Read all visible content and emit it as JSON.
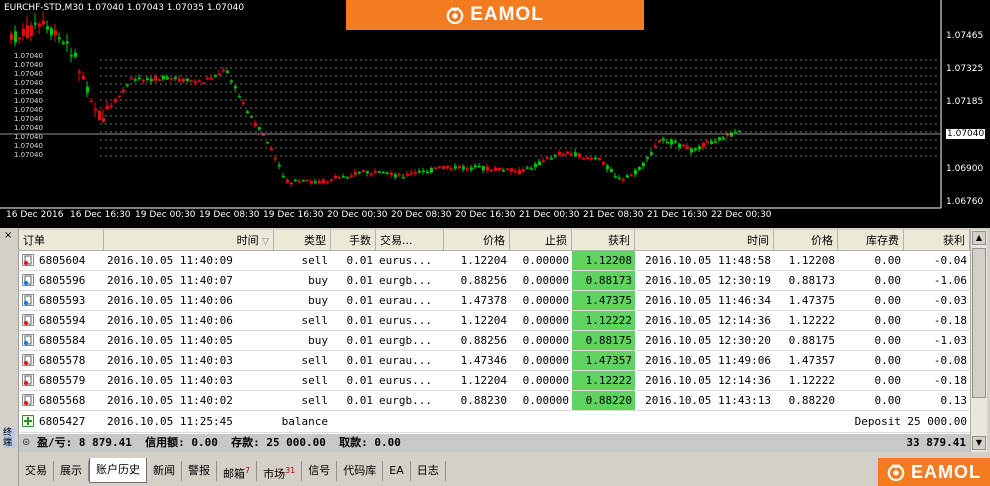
{
  "chart": {
    "title": "EURCHF-STD,M30  1.07040 1.07043 1.07035 1.07040",
    "y_labels": [
      "1.07465",
      "1.07325",
      "1.07185",
      "1.07040",
      "1.06900",
      "1.06760"
    ],
    "x_labels": [
      "16 Dec 2016",
      "16 Dec 16:30",
      "19 Dec 00:30",
      "19 Dec 08:30",
      "19 Dec 16:30",
      "20 Dec 00:30",
      "20 Dec 08:30",
      "20 Dec 16:30",
      "21 Dec 00:30",
      "21 Dec 08:30",
      "21 Dec 16:30",
      "22 Dec 00:30"
    ],
    "current_price": "1.07040",
    "colors": {
      "background": "#000000",
      "bull": "#00c800",
      "bear": "#e01010",
      "grid": "#ffffff"
    },
    "level_label_text": "1.07040"
  },
  "brand": {
    "text": "EAMOL",
    "color": "#f47c20"
  },
  "terminal": {
    "close_glyph": "×",
    "vertical_title": "终端",
    "headers": {
      "order": "订单",
      "time": "时间",
      "type": "类型",
      "lots": "手数",
      "symbol": "交易...",
      "price": "价格",
      "sl": "止损",
      "tp": "获利",
      "time2": "时间",
      "price2": "价格",
      "swap": "库存费",
      "profit": "获利"
    },
    "rows": [
      {
        "order": "6805604",
        "open_time": "2016.10.05 11:40:09",
        "type": "sell",
        "lots": "0.01",
        "symbol": "eurus...",
        "price": "1.12204",
        "sl": "0.00000",
        "tp": "1.12208",
        "close_time": "2016.10.05 11:48:58",
        "close_price": "1.12208",
        "swap": "0.00",
        "profit": "-0.04"
      },
      {
        "order": "6805596",
        "open_time": "2016.10.05 11:40:07",
        "type": "buy",
        "lots": "0.01",
        "symbol": "eurgb...",
        "price": "0.88256",
        "sl": "0.00000",
        "tp": "0.88173",
        "close_time": "2016.10.05 12:30:19",
        "close_price": "0.88173",
        "swap": "0.00",
        "profit": "-1.06"
      },
      {
        "order": "6805593",
        "open_time": "2016.10.05 11:40:06",
        "type": "buy",
        "lots": "0.01",
        "symbol": "eurau...",
        "price": "1.47378",
        "sl": "0.00000",
        "tp": "1.47375",
        "close_time": "2016.10.05 11:46:34",
        "close_price": "1.47375",
        "swap": "0.00",
        "profit": "-0.03"
      },
      {
        "order": "6805594",
        "open_time": "2016.10.05 11:40:06",
        "type": "sell",
        "lots": "0.01",
        "symbol": "eurus...",
        "price": "1.12204",
        "sl": "0.00000",
        "tp": "1.12222",
        "close_time": "2016.10.05 12:14:36",
        "close_price": "1.12222",
        "swap": "0.00",
        "profit": "-0.18"
      },
      {
        "order": "6805584",
        "open_time": "2016.10.05 11:40:05",
        "type": "buy",
        "lots": "0.01",
        "symbol": "eurgb...",
        "price": "0.88256",
        "sl": "0.00000",
        "tp": "0.88175",
        "close_time": "2016.10.05 12:30:20",
        "close_price": "0.88175",
        "swap": "0.00",
        "profit": "-1.03"
      },
      {
        "order": "6805578",
        "open_time": "2016.10.05 11:40:03",
        "type": "sell",
        "lots": "0.01",
        "symbol": "eurau...",
        "price": "1.47346",
        "sl": "0.00000",
        "tp": "1.47357",
        "close_time": "2016.10.05 11:49:06",
        "close_price": "1.47357",
        "swap": "0.00",
        "profit": "-0.08"
      },
      {
        "order": "6805579",
        "open_time": "2016.10.05 11:40:03",
        "type": "sell",
        "lots": "0.01",
        "symbol": "eurus...",
        "price": "1.12204",
        "sl": "0.00000",
        "tp": "1.12222",
        "close_time": "2016.10.05 12:14:36",
        "close_price": "1.12222",
        "swap": "0.00",
        "profit": "-0.18"
      },
      {
        "order": "6805568",
        "open_time": "2016.10.05 11:40:02",
        "type": "sell",
        "lots": "0.01",
        "symbol": "eurgb...",
        "price": "0.88230",
        "sl": "0.00000",
        "tp": "0.88220",
        "close_time": "2016.10.05 11:43:13",
        "close_price": "0.88220",
        "swap": "0.00",
        "profit": "0.13"
      }
    ],
    "balance_row": {
      "order": "6805427",
      "open_time": "2016.10.05 11:25:45",
      "type": "balance",
      "comment": "Deposit",
      "profit": "25 000.00"
    },
    "summary": {
      "text": "盈/亏: 8 879.41  信用额: 0.00  存款: 25 000.00  取款: 0.00",
      "total": "33 879.41"
    },
    "tabs": [
      {
        "label": "交易",
        "badge": ""
      },
      {
        "label": "展示",
        "badge": ""
      },
      {
        "label": "账户历史",
        "badge": "",
        "active": true
      },
      {
        "label": "新闻",
        "badge": ""
      },
      {
        "label": "警报",
        "badge": ""
      },
      {
        "label": "邮箱",
        "badge": "7"
      },
      {
        "label": "市场",
        "badge": "31"
      },
      {
        "label": "信号",
        "badge": ""
      },
      {
        "label": "代码库",
        "badge": ""
      },
      {
        "label": "EA",
        "badge": ""
      },
      {
        "label": "日志",
        "badge": ""
      }
    ]
  }
}
